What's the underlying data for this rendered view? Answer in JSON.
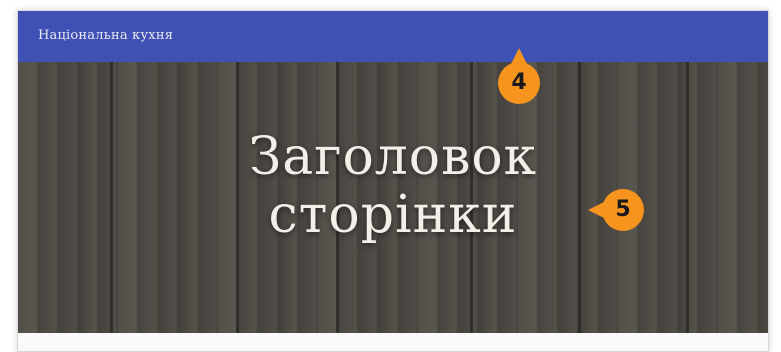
{
  "navbar": {
    "brand": "Національна кухня",
    "background_color": "#3f51b5"
  },
  "hero": {
    "title_line_1": "Заголовок",
    "title_line_2": "сторінки"
  },
  "callouts": {
    "navbar_marker": "4",
    "title_marker": "5",
    "color": "#f7941d"
  }
}
